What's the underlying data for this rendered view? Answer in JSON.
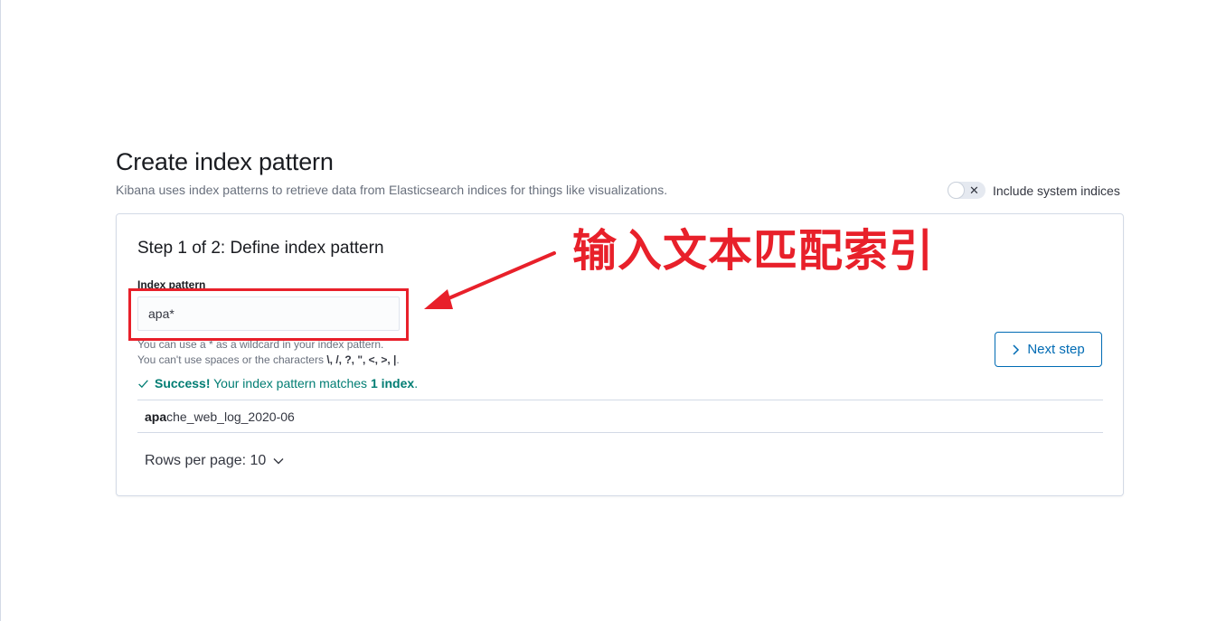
{
  "header": {
    "title": "Create index pattern",
    "subtitle": "Kibana uses index patterns to retrieve data from Elasticsearch indices for things like visualizations.",
    "system_toggle": {
      "label": "Include system indices",
      "checked": false,
      "off_glyph": "✕"
    }
  },
  "step": {
    "title": "Step 1 of 2: Define index pattern",
    "field_label": "Index pattern",
    "input_value": "apa*",
    "help_line_1": "You can use a * as a wildcard in your index pattern.",
    "help_line_2_prefix": "You can't use spaces or the characters ",
    "help_line_2_chars": "\\, /, ?, \", <, >, |",
    "help_line_2_suffix": ".",
    "next_button": "Next step",
    "success": {
      "strong": "Success!",
      "text": " Your index pattern matches ",
      "count": "1 index",
      "end": "."
    },
    "matched_indices": [
      {
        "match": "apa",
        "rest": "che_web_log_2020-06"
      }
    ],
    "rows_per_page": "Rows per page: 10"
  },
  "annotation": {
    "text": "输入文本匹配索引",
    "color": "#e8202a"
  },
  "colors": {
    "primary": "#006bb4",
    "success": "#017d73",
    "annotation": "#e8202a"
  },
  "icons": [
    "close-icon",
    "check-icon",
    "chevron-right-icon",
    "chevron-down-icon",
    "arrow-icon"
  ]
}
